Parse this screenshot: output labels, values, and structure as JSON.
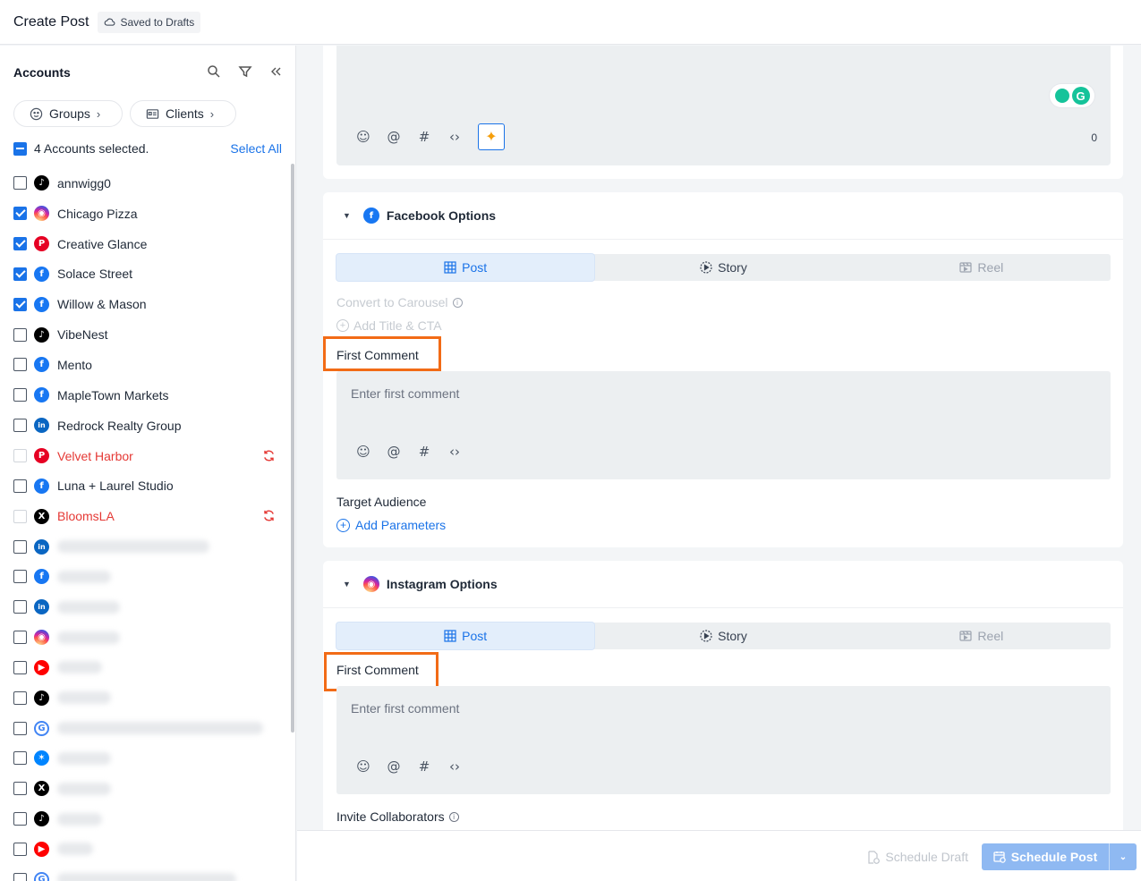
{
  "header": {
    "title": "Create Post",
    "saved_label": "Saved to Drafts",
    "saved_icon": "cloud-icon"
  },
  "sidebar": {
    "heading": "Accounts",
    "groups_label": "Groups",
    "clients_label": "Clients",
    "selected_text": "4 Accounts selected.",
    "select_all": "Select All",
    "accounts": [
      {
        "name": "annwigg0",
        "network": "tiktok",
        "checked": false,
        "error": false
      },
      {
        "name": "Chicago Pizza",
        "network": "instagram",
        "checked": true,
        "error": false
      },
      {
        "name": "Creative Glance",
        "network": "pinterest",
        "checked": true,
        "error": false
      },
      {
        "name": "Solace Street",
        "network": "facebook",
        "checked": true,
        "error": false
      },
      {
        "name": "Willow & Mason",
        "network": "facebook",
        "checked": true,
        "error": false
      },
      {
        "name": "VibeNest",
        "network": "tiktok",
        "checked": false,
        "error": false
      },
      {
        "name": "Mento",
        "network": "facebook",
        "checked": false,
        "error": false
      },
      {
        "name": "MapleTown Markets",
        "network": "facebook",
        "checked": false,
        "error": false
      },
      {
        "name": "Redrock Realty Group",
        "network": "linkedin",
        "checked": false,
        "error": false
      },
      {
        "name": "Velvet Harbor",
        "network": "pinterest",
        "checked": false,
        "error": true
      },
      {
        "name": "Luna + Laurel Studio",
        "network": "facebook",
        "checked": false,
        "error": false
      },
      {
        "name": "BloomsLA",
        "network": "x",
        "checked": false,
        "error": true
      }
    ],
    "blurred_accounts": [
      "linkedin",
      "facebook",
      "linkedin",
      "instagram",
      "youtube",
      "tiktok",
      "google",
      "bluesky",
      "x",
      "tiktok",
      "youtube",
      "google"
    ]
  },
  "editor": {
    "char_count": "0"
  },
  "facebook_options": {
    "title": "Facebook Options",
    "tabs": {
      "post": "Post",
      "story": "Story",
      "reel": "Reel"
    },
    "convert_carousel": "Convert to Carousel",
    "add_title_cta": "Add Title & CTA",
    "first_comment_label": "First Comment",
    "first_comment_placeholder": "Enter first comment",
    "target_audience_label": "Target Audience",
    "add_parameters": "Add Parameters"
  },
  "instagram_options": {
    "title": "Instagram Options",
    "tabs": {
      "post": "Post",
      "story": "Story",
      "reel": "Reel"
    },
    "first_comment_label": "First Comment",
    "first_comment_placeholder": "Enter first comment",
    "invite_collaborators": "Invite Collaborators"
  },
  "footer": {
    "schedule_draft": "Schedule Draft",
    "schedule_post": "Schedule Post"
  },
  "colors": {
    "accent": "#1a73e8",
    "highlight": "#f26b16",
    "error": "#e53935"
  }
}
